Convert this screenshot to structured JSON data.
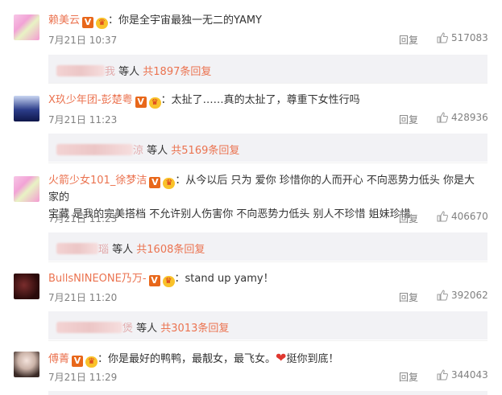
{
  "comments": [
    {
      "name": "赖美云",
      "text": "：你是全宇宙最独一无二的YAMY",
      "time": "7月21日 10:37",
      "reply": "回复",
      "likes": "517083",
      "sub_tail": "我",
      "sub_mid": " 等人 ",
      "sub_count": "共1897条回复"
    },
    {
      "name": "X玖少年团-彭楚粤",
      "text": "：太扯了……真的太扯了，尊重下女性行吗",
      "time": "7月21日 11:23",
      "reply": "回复",
      "likes": "428936",
      "sub_tail": "涼",
      "sub_mid": " 等人 ",
      "sub_count": "共5169条回复"
    },
    {
      "name": "火箭少女101_徐梦洁",
      "text": "：从今以后 只为 爱你 珍惜你的人而开心 不向恶势力低头 你是大家的",
      "text2": "宝藏 是我的完美搭档 不允许别人伤害你 不向恶势力低头 别人不珍惜 姐妹珍惜",
      "time": "7月21日 11:23",
      "reply": "回复",
      "likes": "406670",
      "sub_tail": "瑙",
      "sub_mid": " 等人 ",
      "sub_count": "共1608条回复"
    },
    {
      "name": "BullsNINEONE乃万-",
      "text": "：stand up yamy！",
      "time": "7月21日 11:20",
      "reply": "回复",
      "likes": "392062",
      "sub_tail": "煲",
      "sub_mid": " 等人 ",
      "sub_count": "共3013条回复"
    },
    {
      "name": "傅菁",
      "text": "：你是最好的鸭鸭，最靓女，最飞女。",
      "text_after": "挺你到底！",
      "time": "7月21日 11:29",
      "reply": "回复",
      "likes": "344043"
    }
  ],
  "icons": {
    "verified": "V",
    "vip": "vip-crown-icon"
  }
}
